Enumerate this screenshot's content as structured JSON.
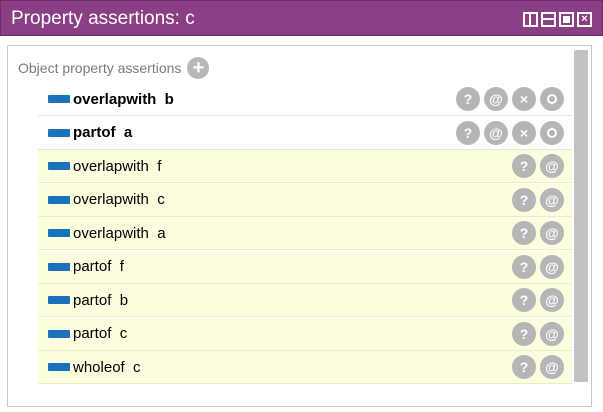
{
  "window": {
    "title": "Property assertions: c",
    "controls": [
      "split-vertical-icon",
      "split-horizontal-icon",
      "maximize-icon",
      "close-icon"
    ]
  },
  "section": {
    "label": "Object property assertions",
    "add_icon": "+"
  },
  "asserted": [
    {
      "text": "overlapwith  b",
      "actions": [
        "?",
        "@",
        "×",
        "o"
      ]
    },
    {
      "text": "partof  a",
      "actions": [
        "?",
        "@",
        "×",
        "o"
      ]
    }
  ],
  "inferred": [
    {
      "text": "overlapwith  f",
      "actions": [
        "?",
        "@"
      ]
    },
    {
      "text": "overlapwith  c",
      "actions": [
        "?",
        "@"
      ]
    },
    {
      "text": "overlapwith  a",
      "actions": [
        "?",
        "@"
      ]
    },
    {
      "text": "partof  f",
      "actions": [
        "?",
        "@"
      ]
    },
    {
      "text": "partof  b",
      "actions": [
        "?",
        "@"
      ]
    },
    {
      "text": "partof  c",
      "actions": [
        "?",
        "@"
      ]
    },
    {
      "text": "wholeof  c",
      "actions": [
        "?",
        "@"
      ]
    }
  ],
  "colors": {
    "titlebar": "#8a3e83",
    "property_icon": "#1a73ba",
    "inferred_background": "#fcfcdf",
    "action_button": "#b5b5b5"
  }
}
